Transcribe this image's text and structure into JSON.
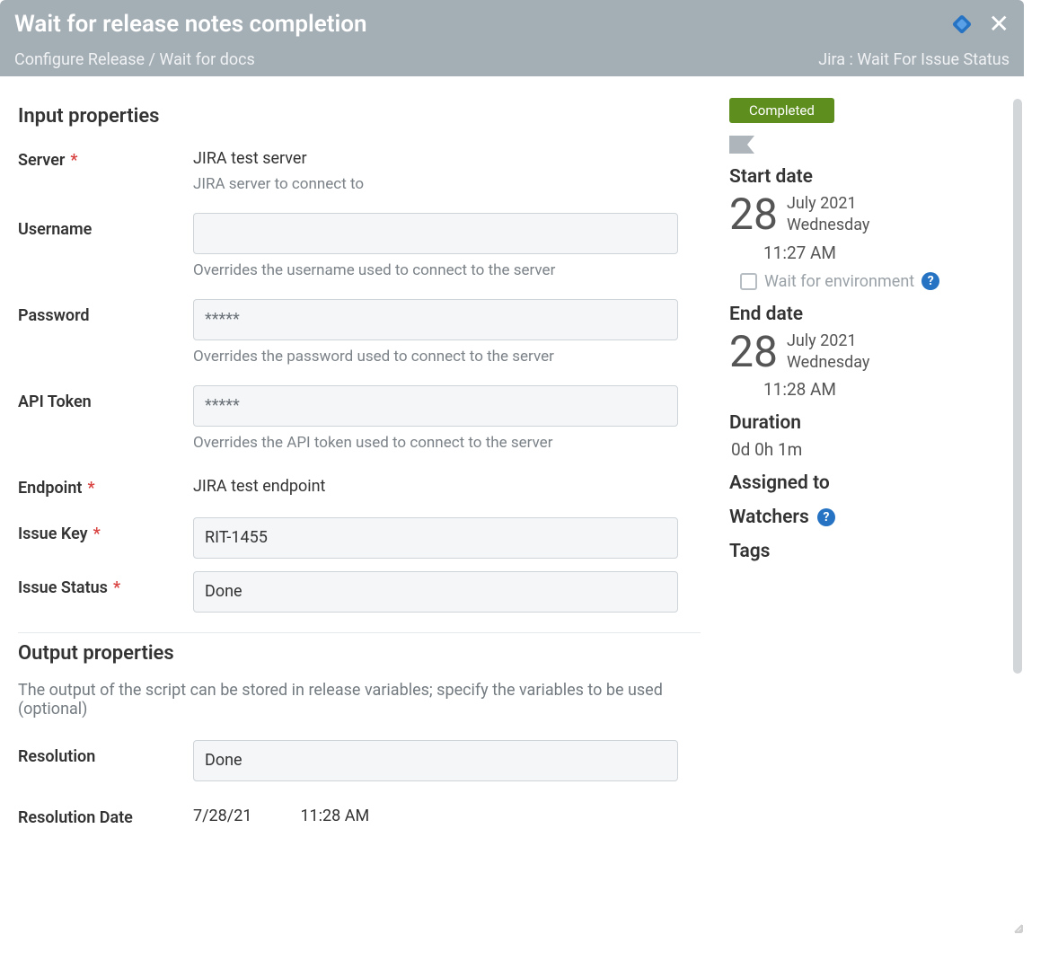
{
  "header": {
    "title": "Wait for release notes completion",
    "breadcrumb": "Configure Release / Wait for docs",
    "task_type": "Jira : Wait For Issue Status"
  },
  "sections": {
    "input": {
      "heading": "Input properties",
      "server": {
        "label": "Server",
        "required": true,
        "value": "JIRA test server",
        "hint": "JIRA server to connect to"
      },
      "username": {
        "label": "Username",
        "value": "",
        "hint": "Overrides the username used to connect to the server"
      },
      "password": {
        "label": "Password",
        "masked": "*****",
        "hint": "Overrides the password used to connect to the server"
      },
      "api_token": {
        "label": "API Token",
        "masked": "*****",
        "hint": "Overrides the API token used to connect to the server"
      },
      "endpoint": {
        "label": "Endpoint",
        "required": true,
        "value": "JIRA test endpoint"
      },
      "issue_key": {
        "label": "Issue Key",
        "required": true,
        "value": "RIT-1455"
      },
      "issue_status": {
        "label": "Issue Status",
        "required": true,
        "value": "Done"
      }
    },
    "output": {
      "heading": "Output properties",
      "description": "The output of the script can be stored in release variables; specify the variables to be used (optional)",
      "resolution": {
        "label": "Resolution",
        "value": "Done"
      },
      "resolution_date": {
        "label": "Resolution Date",
        "date": "7/28/21",
        "time": "11:28 AM"
      }
    }
  },
  "side": {
    "status_badge": "Completed",
    "start": {
      "label": "Start date",
      "day": "28",
      "month_year": "July 2021",
      "weekday": "Wednesday",
      "time": "11:27 AM"
    },
    "wait_env_label": "Wait for environment",
    "end": {
      "label": "End date",
      "day": "28",
      "month_year": "July 2021",
      "weekday": "Wednesday",
      "time": "11:28 AM"
    },
    "duration": {
      "label": "Duration",
      "value": "0d 0h 1m"
    },
    "assigned_to": "Assigned to",
    "watchers": "Watchers",
    "tags": "Tags"
  }
}
